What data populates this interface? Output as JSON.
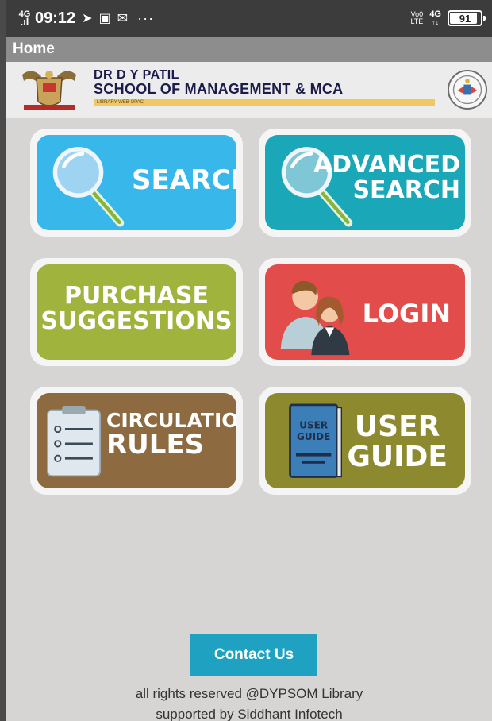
{
  "status_bar": {
    "network_top": "4G",
    "network_bottom": "LTE",
    "time": "09:12",
    "more": "···",
    "volte_top": "Vo0",
    "volte_bottom": "LTE",
    "net_type": "4G",
    "battery_level": "91",
    "battery_fraction": 0.91
  },
  "app_bar": {
    "title": "Home"
  },
  "header": {
    "line1": "DR D Y PATIL",
    "line2": "SCHOOL OF MANAGEMENT & MCA",
    "strip": "LIBRARY WEB OPAC"
  },
  "tiles": [
    {
      "id": "search",
      "lines": [
        "SEARCH"
      ],
      "icon": "magnifier-icon",
      "color": "#37b7ea"
    },
    {
      "id": "advanced-search",
      "lines": [
        "ADVANCED",
        "SEARCH"
      ],
      "icon": "magnifier-icon",
      "color": "#1aa7b8"
    },
    {
      "id": "purchase-suggestions",
      "lines": [
        "PURCHASE",
        "SUGGESTIONS"
      ],
      "icon": "",
      "color": "#9fb33d"
    },
    {
      "id": "login",
      "lines": [
        "LOGIN"
      ],
      "icon": "users-icon",
      "color": "#e24d4b"
    },
    {
      "id": "circulation-rules",
      "lines": [
        "CIRCULATION",
        "RULES"
      ],
      "icon": "checklist-icon",
      "color": "#8d6a40"
    },
    {
      "id": "user-guide",
      "lines": [
        "USER",
        "GUIDE"
      ],
      "icon": "book-icon",
      "color": "#8c892f",
      "book_text": [
        "USER",
        "GUIDE"
      ]
    }
  ],
  "contact_button": "Contact Us",
  "footer": {
    "line1": "all rights reserved @DYPSOM Library",
    "line2": "supported by Siddhant Infotech"
  }
}
